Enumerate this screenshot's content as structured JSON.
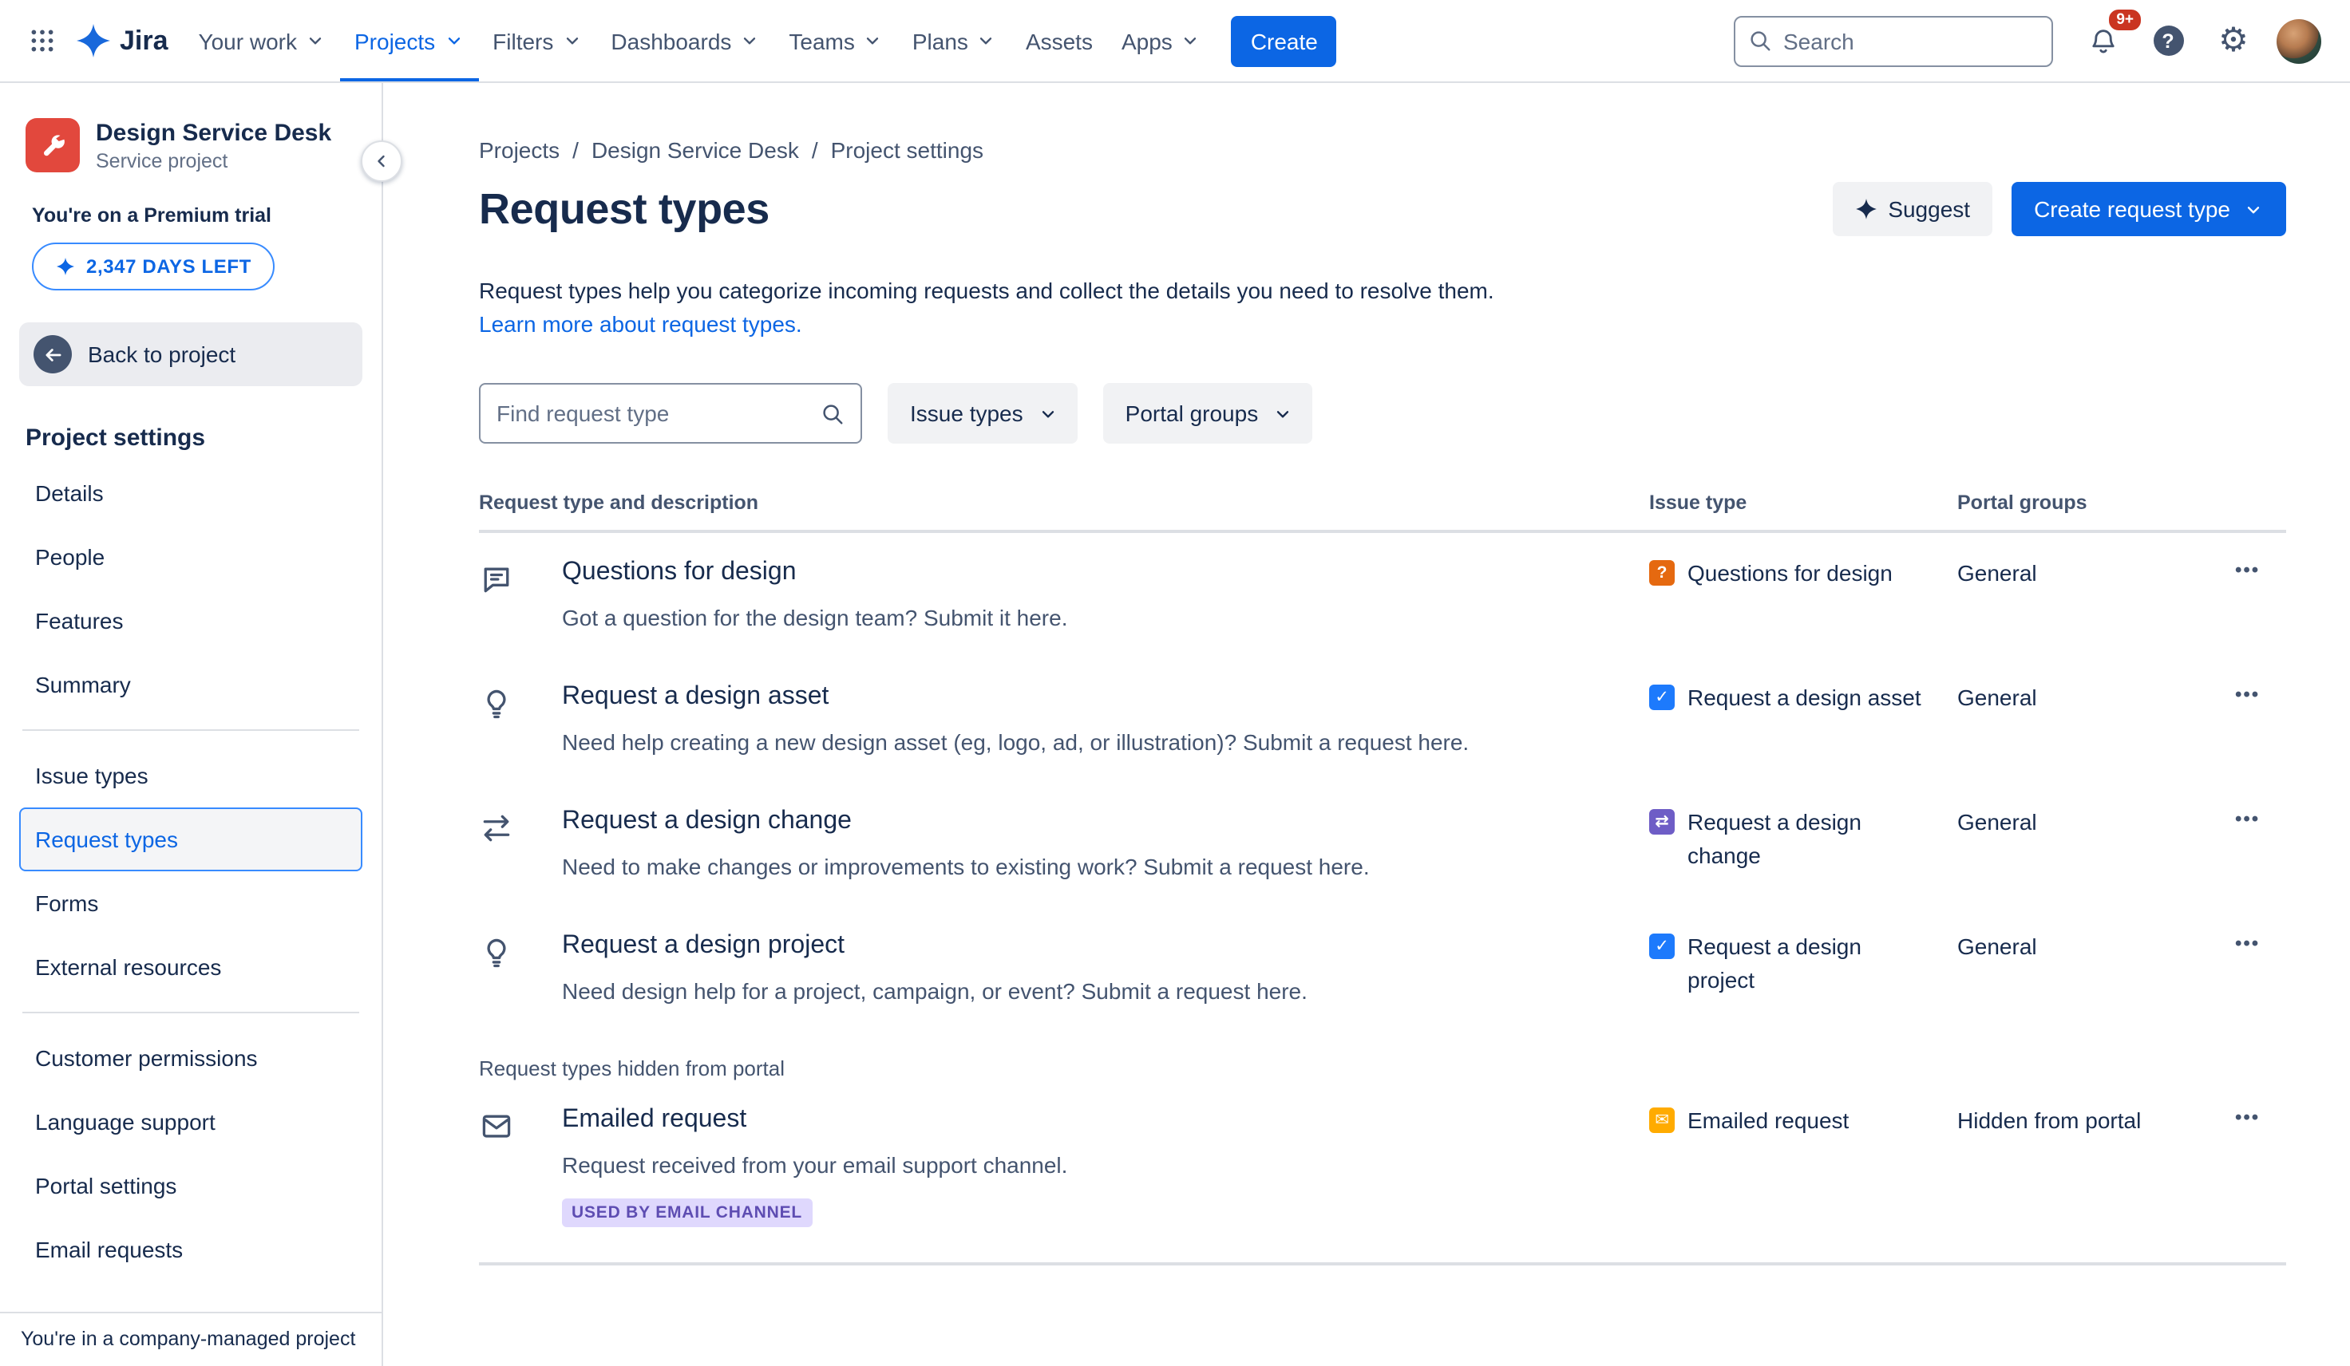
{
  "navbar": {
    "logo_text": "Jira",
    "items": [
      {
        "label": "Your work"
      },
      {
        "label": "Projects"
      },
      {
        "label": "Filters"
      },
      {
        "label": "Dashboards"
      },
      {
        "label": "Teams"
      },
      {
        "label": "Plans"
      },
      {
        "label": "Assets"
      },
      {
        "label": "Apps"
      }
    ],
    "create_label": "Create",
    "search_placeholder": "Search",
    "notification_count": "9+"
  },
  "icons": {
    "gear": "⚙",
    "help": "?",
    "more": "•••",
    "breadcrumb_separator": "/"
  },
  "sidebar": {
    "project_name": "Design Service Desk",
    "project_type": "Service project",
    "trial_text": "You're on a Premium trial",
    "trial_days_label": "2,347 DAYS LEFT",
    "back_label": "Back to project",
    "settings_heading": "Project settings",
    "groups": [
      {
        "items": [
          {
            "label": "Details"
          },
          {
            "label": "People"
          },
          {
            "label": "Features"
          },
          {
            "label": "Summary"
          }
        ]
      },
      {
        "items": [
          {
            "label": "Issue types"
          },
          {
            "label": "Request types"
          },
          {
            "label": "Forms"
          },
          {
            "label": "External resources"
          }
        ]
      },
      {
        "items": [
          {
            "label": "Customer permissions"
          },
          {
            "label": "Language support"
          },
          {
            "label": "Portal settings"
          },
          {
            "label": "Email requests"
          }
        ]
      }
    ],
    "selected_item": "Request types",
    "footer_note": "You're in a company-managed project"
  },
  "main": {
    "breadcrumb": [
      {
        "label": "Projects"
      },
      {
        "label": "Design Service Desk"
      },
      {
        "label": "Project settings"
      }
    ],
    "title": "Request types",
    "suggest_label": "Suggest",
    "create_request_label": "Create request type",
    "intro": "Request types help you categorize incoming requests and collect the details you need to resolve them.",
    "learn_more": "Learn more about request types.",
    "find_placeholder": "Find request type",
    "issue_types_filter": "Issue types",
    "portal_groups_filter": "Portal groups",
    "table": {
      "col_request": "Request type and description",
      "col_issue": "Issue type",
      "col_portal": "Portal groups",
      "rows": [
        {
          "icon": "comment-icon",
          "title": "Questions for design",
          "description": "Got a question for the design team? Submit it here.",
          "issue_type": "Questions for design",
          "issue_color": "#E56910",
          "issue_glyph": "?",
          "portal_group": "General"
        },
        {
          "icon": "lightbulb-icon",
          "title": "Request a design asset",
          "description": "Need help creating a new design asset (eg, logo, ad, or illustration)? Submit a request here.",
          "issue_type": "Request a design asset",
          "issue_color": "#1D7AFC",
          "issue_glyph": "✓",
          "portal_group": "General"
        },
        {
          "icon": "swap-arrows-icon",
          "title": "Request a design change",
          "description": "Need to make changes or improvements to existing work? Submit a request here.",
          "issue_type": "Request a design change",
          "issue_color": "#6E5DC6",
          "issue_glyph": "⇄",
          "portal_group": "General"
        },
        {
          "icon": "lightbulb-icon",
          "title": "Request a design project",
          "description": "Need design help for a project, campaign, or event? Submit a request here.",
          "issue_type": "Request a design project",
          "issue_color": "#1D7AFC",
          "issue_glyph": "✓",
          "portal_group": "General"
        }
      ],
      "hidden_section_label": "Request types hidden from portal",
      "hidden_rows": [
        {
          "icon": "envelope-icon",
          "title": "Emailed request",
          "description": "Request received from your email support channel.",
          "badge": "USED BY EMAIL CHANNEL",
          "issue_type": "Emailed request",
          "issue_color": "#FFAB00",
          "issue_glyph": "✉",
          "portal_group": "Hidden from portal"
        }
      ]
    }
  },
  "colors": {
    "brand_blue": "#0C66E4",
    "active_nav": "#0C66E4",
    "selected_border": "#388BFF",
    "notification_red": "#CA3521",
    "badge_bg": "#DFD8FD",
    "badge_text": "#5E4DB2"
  }
}
